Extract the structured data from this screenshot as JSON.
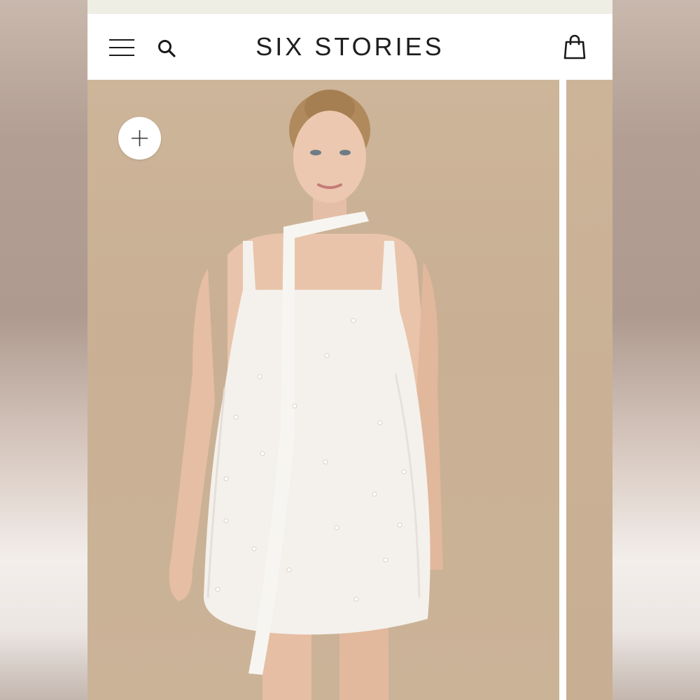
{
  "header": {
    "brand": "SIX STORIES",
    "menu_icon": "hamburger-menu-icon",
    "search_icon": "search-icon",
    "bag_icon": "shopping-bag-icon"
  },
  "gallery": {
    "zoom_icon": "plus-icon",
    "image_description": "product-photo-white-mini-dress"
  },
  "colors": {
    "photo_background": "#cdb59a",
    "navbar": "#ffffff",
    "text": "#1e1e1e"
  }
}
